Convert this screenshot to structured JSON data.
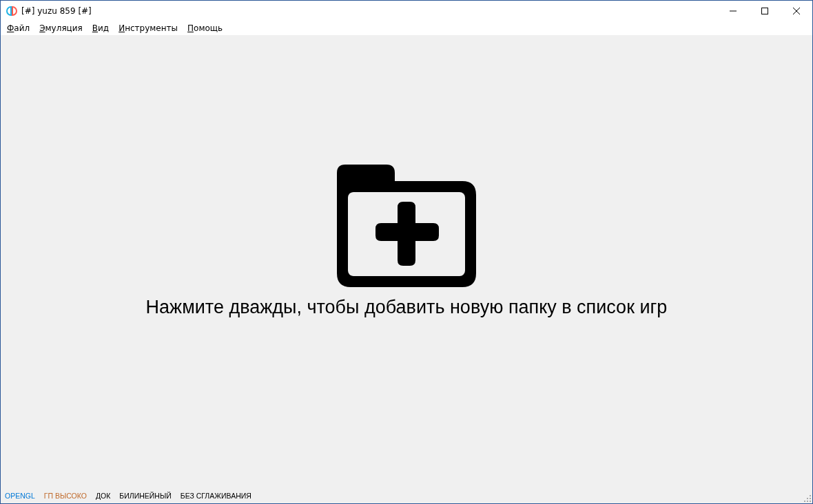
{
  "window": {
    "title": "[#] yuzu 859 [#]"
  },
  "menu": [
    "Файл",
    "Эмуляция",
    "Вид",
    "Инструменты",
    "Помощь"
  ],
  "game_list": {
    "hint": "Нажмите дважды, чтобы добавить новую папку в список игр"
  },
  "status_bar": [
    {
      "label": "OPENGL",
      "color": "#0078d7"
    },
    {
      "label": "ГП ВЫСОКО",
      "color": "#c06a2b"
    },
    {
      "label": "ДОК",
      "color": "#000000"
    },
    {
      "label": "БИЛИНЕЙНЫЙ",
      "color": "#000000"
    },
    {
      "label": "БЕЗ СГЛАЖИВАНИЯ",
      "color": "#000000"
    }
  ]
}
